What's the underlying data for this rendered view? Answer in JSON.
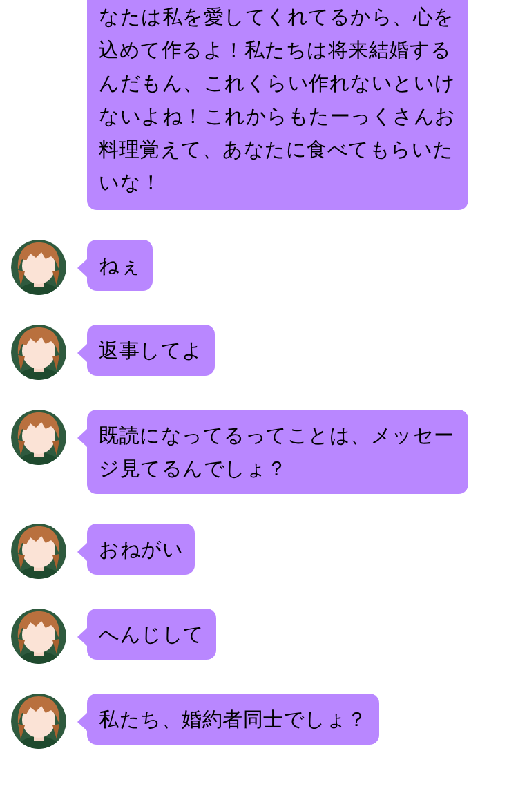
{
  "messages": [
    {
      "show_avatar": false,
      "text": "なたは私を愛してくれてるから、心を込めて作るよ！私たちは将来結婚するんだもん、これくらい作れないといけないよね！これからもたーっくさんお料理覚えて、あなたに食べてもらいたいな！"
    },
    {
      "show_avatar": true,
      "text": "ねぇ"
    },
    {
      "show_avatar": true,
      "text": "返事してよ"
    },
    {
      "show_avatar": true,
      "text": "既読になってるってことは、メッセージ見てるんでしょ？"
    },
    {
      "show_avatar": true,
      "text": "おねがい"
    },
    {
      "show_avatar": true,
      "text": "へんじして"
    },
    {
      "show_avatar": true,
      "text": "私たち、婚約者同士でしょ？"
    }
  ]
}
